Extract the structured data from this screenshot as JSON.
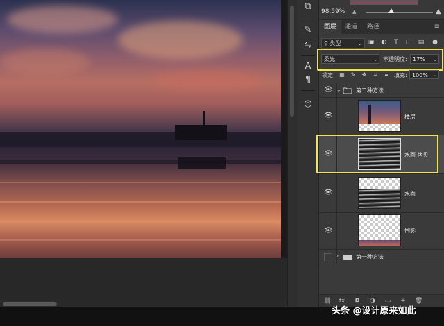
{
  "navigator": {
    "zoom": "98.59%"
  },
  "panel": {
    "tabs": [
      {
        "label": "图层",
        "active": true
      },
      {
        "label": "通道",
        "active": false
      },
      {
        "label": "路径",
        "active": false
      }
    ],
    "filter": {
      "kind": "类型"
    },
    "blend_mode": "柔光",
    "opacity_label": "不透明度:",
    "opacity_value": "17%",
    "lock_label": "锁定:",
    "fill_label": "填充:",
    "fill_value": "100%"
  },
  "layers": [
    {
      "name": "第二种方法",
      "type": "group",
      "visible": true,
      "expanded": true
    },
    {
      "name": "楼房",
      "type": "image",
      "visible": true,
      "selected": false
    },
    {
      "name": "水面 拷贝",
      "type": "water",
      "visible": true,
      "selected": true
    },
    {
      "name": "水面",
      "type": "water",
      "visible": true,
      "selected": false
    },
    {
      "name": "倒影",
      "type": "reflection",
      "visible": true,
      "selected": false
    },
    {
      "name": "第一种方法",
      "type": "group",
      "visible": false,
      "expanded": false
    }
  ],
  "watermark": "头条 @设计原来如此",
  "icons": [
    "eye-icon",
    "folder-icon",
    "search-icon",
    "brush-icon",
    "text-tool-icon",
    "paragraph-icon",
    "adjust-icon",
    "cube-icon"
  ]
}
